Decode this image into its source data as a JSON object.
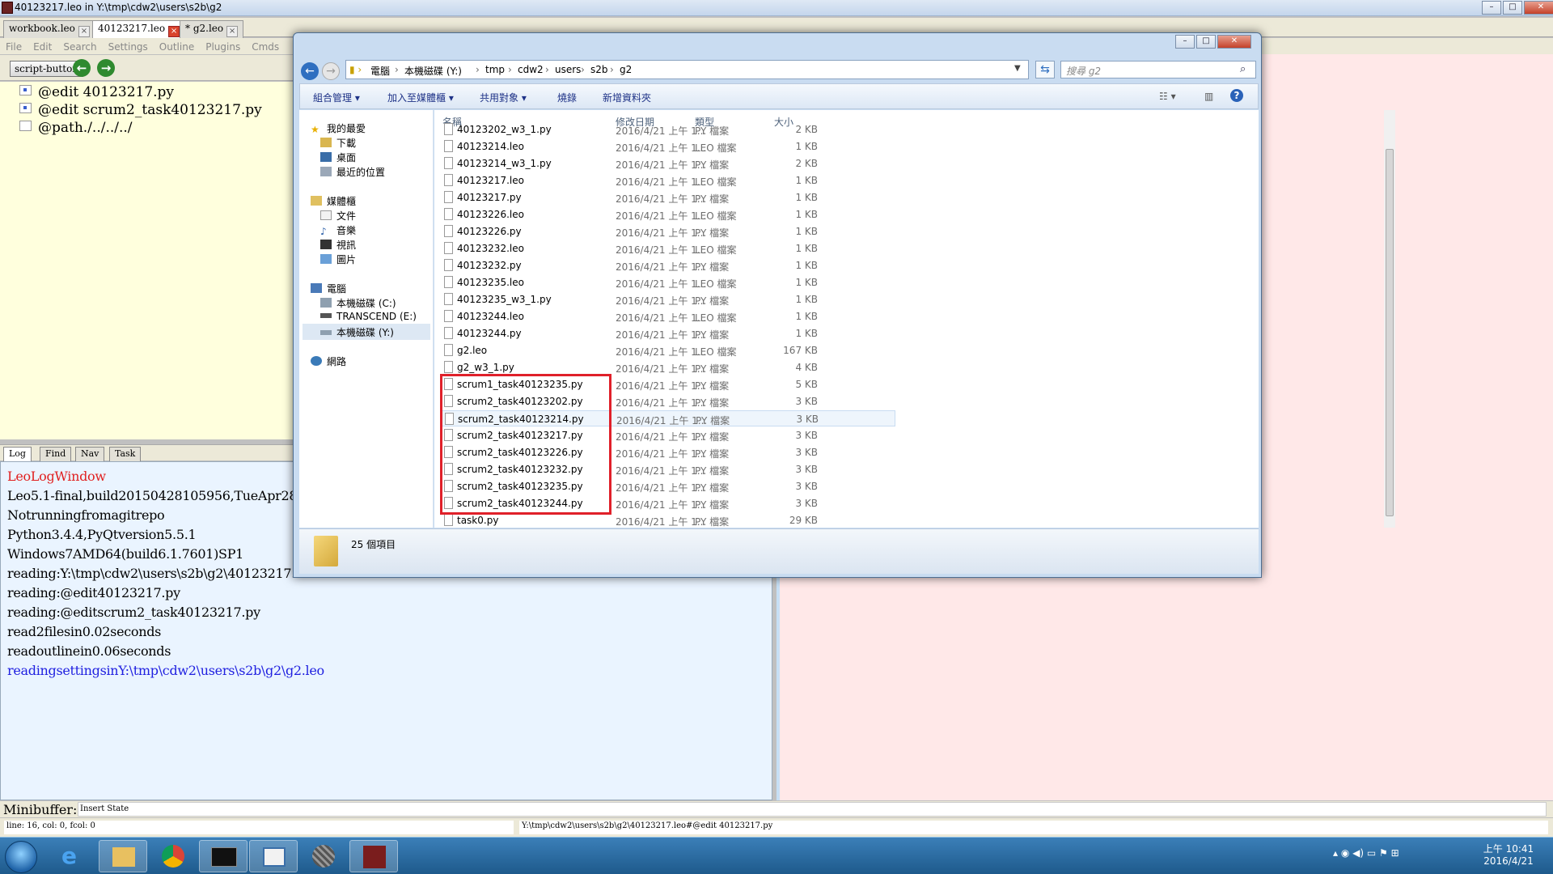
{
  "leo": {
    "title": "40123217.leo in Y:\\tmp\\cdw2\\users\\s2b\\g2",
    "tabs": [
      {
        "label": "workbook.leo"
      },
      {
        "label": "40123217.leo"
      },
      {
        "label": "* g2.leo"
      }
    ],
    "menu": [
      "File",
      "Edit",
      "Search",
      "Settings",
      "Outline",
      "Plugins",
      "Cmds"
    ],
    "toolbar": {
      "script_button": "script-button"
    },
    "outline": [
      {
        "text": "@edit 40123217.py"
      },
      {
        "text": "@edit scrum2_task40123217.py"
      },
      {
        "text": "@path./../../../"
      }
    ],
    "log_tabs": [
      "Log",
      "Find",
      "Nav",
      "Task"
    ],
    "log_lines": [
      {
        "text": "LeoLogWindow",
        "color": "#e02020"
      },
      {
        "text": "Leo5.1-final,build20150428105956,TueApr2810",
        "color": "#000000"
      },
      {
        "text": "Notrunningfromagitrepo",
        "color": "#000000"
      },
      {
        "text": "Python3.4.4,PyQtversion5.5.1",
        "color": "#000000"
      },
      {
        "text": "Windows7AMD64(build6.1.7601)SP1",
        "color": "#000000"
      },
      {
        "text": "reading:Y:\\tmp\\cdw2\\users\\s2b\\g2\\40123217.leo",
        "color": "#000000"
      },
      {
        "text": "reading:@edit40123217.py",
        "color": "#000000"
      },
      {
        "text": "reading:@editscrum2_task40123217.py",
        "color": "#000000"
      },
      {
        "text": "read2filesin0.02seconds",
        "color": "#000000"
      },
      {
        "text": "readoutlinein0.06seconds",
        "color": "#000000"
      },
      {
        "text": "readingsettingsinY:\\tmp\\cdw2\\users\\s2b\\g2\\g2.leo",
        "color": "#2020e0"
      }
    ],
    "minibuffer": {
      "label": "Minibuffer:",
      "value": "Insert State"
    },
    "status": {
      "left": "line: 16, col: 0, fcol: 0",
      "right": "Y:\\tmp\\cdw2\\users\\s2b\\g2\\40123217.leo#@edit 40123217.py"
    }
  },
  "explorer": {
    "breadcrumb": [
      "電腦",
      "本機磁碟 (Y:)",
      "tmp",
      "cdw2",
      "users",
      "s2b",
      "g2"
    ],
    "search_placeholder": "搜尋 g2",
    "commands": [
      "組合管理 ▾",
      "加入至媒體櫃 ▾",
      "共用對象 ▾",
      "燒錄",
      "新增資料夾"
    ],
    "nav": {
      "favorites": "我的最愛",
      "downloads": "下載",
      "desktop": "桌面",
      "recent": "最近的位置",
      "libraries": "媒體櫃",
      "documents": "文件",
      "music": "音樂",
      "videos": "視訊",
      "pictures": "圖片",
      "computer": "電腦",
      "drive_c": "本機磁碟 (C:)",
      "drive_e": "TRANSCEND (E:)",
      "drive_y": "本機磁碟 (Y:)",
      "network": "網路"
    },
    "columns": {
      "name": "名稱",
      "date": "修改日期",
      "type": "類型",
      "size": "大小"
    },
    "files": [
      {
        "name": "40123202_w3_1.py",
        "date": "2016/4/21 上午 1...",
        "type": "PY 檔案",
        "size": "2 KB"
      },
      {
        "name": "40123214.leo",
        "date": "2016/4/21 上午 1...",
        "type": "LEO 檔案",
        "size": "1 KB"
      },
      {
        "name": "40123214_w3_1.py",
        "date": "2016/4/21 上午 1...",
        "type": "PY 檔案",
        "size": "2 KB"
      },
      {
        "name": "40123217.leo",
        "date": "2016/4/21 上午 1...",
        "type": "LEO 檔案",
        "size": "1 KB"
      },
      {
        "name": "40123217.py",
        "date": "2016/4/21 上午 1...",
        "type": "PY 檔案",
        "size": "1 KB"
      },
      {
        "name": "40123226.leo",
        "date": "2016/4/21 上午 1...",
        "type": "LEO 檔案",
        "size": "1 KB"
      },
      {
        "name": "40123226.py",
        "date": "2016/4/21 上午 1...",
        "type": "PY 檔案",
        "size": "1 KB"
      },
      {
        "name": "40123232.leo",
        "date": "2016/4/21 上午 1...",
        "type": "LEO 檔案",
        "size": "1 KB"
      },
      {
        "name": "40123232.py",
        "date": "2016/4/21 上午 1...",
        "type": "PY 檔案",
        "size": "1 KB"
      },
      {
        "name": "40123235.leo",
        "date": "2016/4/21 上午 1...",
        "type": "LEO 檔案",
        "size": "1 KB"
      },
      {
        "name": "40123235_w3_1.py",
        "date": "2016/4/21 上午 1...",
        "type": "PY 檔案",
        "size": "1 KB"
      },
      {
        "name": "40123244.leo",
        "date": "2016/4/21 上午 1...",
        "type": "LEO 檔案",
        "size": "1 KB"
      },
      {
        "name": "40123244.py",
        "date": "2016/4/21 上午 1...",
        "type": "PY 檔案",
        "size": "1 KB"
      },
      {
        "name": "g2.leo",
        "date": "2016/4/21 上午 1...",
        "type": "LEO 檔案",
        "size": "167 KB"
      },
      {
        "name": "g2_w3_1.py",
        "date": "2016/4/21 上午 1...",
        "type": "PY 檔案",
        "size": "4 KB"
      },
      {
        "name": "scrum1_task40123235.py",
        "date": "2016/4/21 上午 1...",
        "type": "PY 檔案",
        "size": "5 KB"
      },
      {
        "name": "scrum2_task40123202.py",
        "date": "2016/4/21 上午 1...",
        "type": "PY 檔案",
        "size": "3 KB"
      },
      {
        "name": "scrum2_task40123214.py",
        "date": "2016/4/21 上午 1...",
        "type": "PY 檔案",
        "size": "3 KB"
      },
      {
        "name": "scrum2_task40123217.py",
        "date": "2016/4/21 上午 1...",
        "type": "PY 檔案",
        "size": "3 KB"
      },
      {
        "name": "scrum2_task40123226.py",
        "date": "2016/4/21 上午 1...",
        "type": "PY 檔案",
        "size": "3 KB"
      },
      {
        "name": "scrum2_task40123232.py",
        "date": "2016/4/21 上午 1...",
        "type": "PY 檔案",
        "size": "3 KB"
      },
      {
        "name": "scrum2_task40123235.py",
        "date": "2016/4/21 上午 1...",
        "type": "PY 檔案",
        "size": "3 KB"
      },
      {
        "name": "scrum2_task40123244.py",
        "date": "2016/4/21 上午 1...",
        "type": "PY 檔案",
        "size": "3 KB"
      },
      {
        "name": "task0.py",
        "date": "2016/4/21 上午 1...",
        "type": "PY 檔案",
        "size": "29 KB"
      }
    ],
    "item_count": "25 個項目"
  },
  "taskbar": {
    "time": "上午 10:41",
    "date": "2016/4/21"
  }
}
